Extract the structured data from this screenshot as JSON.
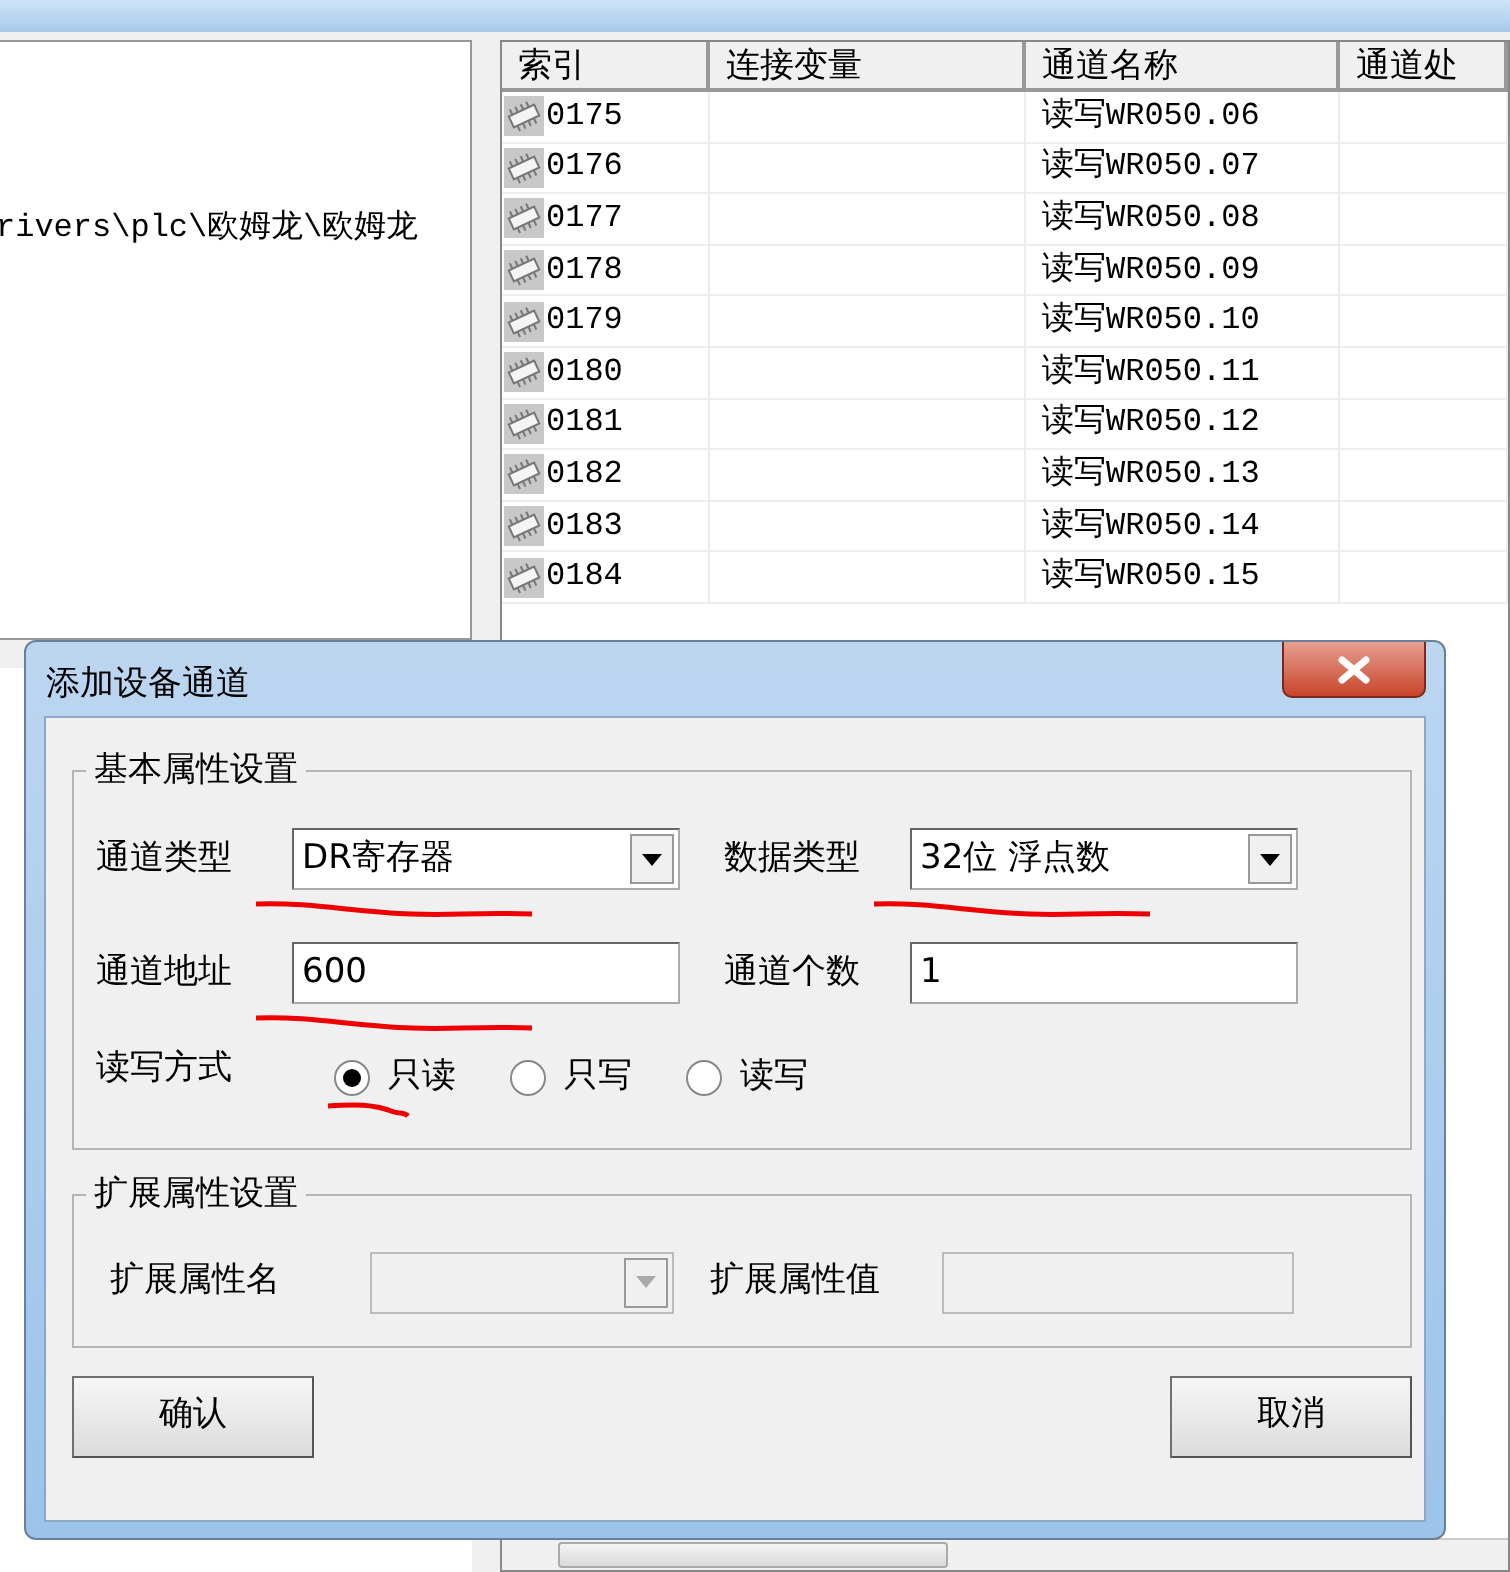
{
  "left_panel": {
    "path_text": "rivers\\plc\\欧姆龙\\欧姆龙"
  },
  "table": {
    "columns": [
      "索引",
      "连接变量",
      "通道名称",
      "通道处"
    ],
    "rows": [
      {
        "index": "0175",
        "name": "读写WR050.06"
      },
      {
        "index": "0176",
        "name": "读写WR050.07"
      },
      {
        "index": "0177",
        "name": "读写WR050.08"
      },
      {
        "index": "0178",
        "name": "读写WR050.09"
      },
      {
        "index": "0179",
        "name": "读写WR050.10"
      },
      {
        "index": "0180",
        "name": "读写WR050.11"
      },
      {
        "index": "0181",
        "name": "读写WR050.12"
      },
      {
        "index": "0182",
        "name": "读写WR050.13"
      },
      {
        "index": "0183",
        "name": "读写WR050.14"
      },
      {
        "index": "0184",
        "name": "读写WR050.15"
      }
    ]
  },
  "dialog": {
    "title": "添加设备通道",
    "basic_group": {
      "legend": "基本属性设置",
      "fields": [
        {
          "label": "通道类型",
          "kind": "combo",
          "value": "DR寄存器",
          "underlined": true,
          "disabled": false
        },
        {
          "label": "数据类型",
          "kind": "combo",
          "value": "32位 浮点数",
          "underlined": true,
          "disabled": false
        },
        {
          "label": "通道地址",
          "kind": "text",
          "value": "600",
          "underlined": true,
          "disabled": false
        },
        {
          "label": "通道个数",
          "kind": "text",
          "value": "1",
          "underlined": false,
          "disabled": false
        }
      ],
      "rw_mode": {
        "label": "读写方式",
        "options": [
          {
            "label": "只读",
            "selected": true,
            "underlined": true
          },
          {
            "label": "只写",
            "selected": false,
            "underlined": false
          },
          {
            "label": "读写",
            "selected": false,
            "underlined": false
          }
        ]
      }
    },
    "ext_group": {
      "legend": "扩展属性设置",
      "fields": [
        {
          "label": "扩展属性名",
          "kind": "combo",
          "disabled": true
        },
        {
          "label": "扩展属性值",
          "kind": "text",
          "disabled": true
        }
      ]
    },
    "buttons": [
      {
        "label": "确认"
      },
      {
        "label": "取消"
      }
    ]
  }
}
